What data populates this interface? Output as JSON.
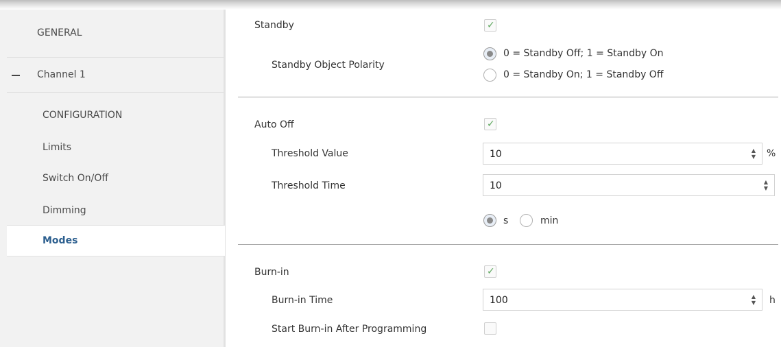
{
  "sidebar": {
    "general": "GENERAL",
    "channel": "Channel 1",
    "items": [
      "CONFIGURATION",
      "Limits",
      "Switch On/Off",
      "Dimming"
    ],
    "selected": "Modes"
  },
  "standby": {
    "label": "Standby",
    "checked": true,
    "polarity_label": "Standby Object Polarity",
    "options": [
      "0 = Standby Off; 1 = Standby On",
      "0 = Standby On; 1 = Standby Off"
    ],
    "selected_index": 0
  },
  "auto_off": {
    "label": "Auto Off",
    "checked": true,
    "threshold_value_label": "Threshold Value",
    "threshold_value": "10",
    "threshold_value_unit": "%",
    "threshold_time_label": "Threshold Time",
    "threshold_time": "10",
    "time_units": [
      "s",
      "min"
    ],
    "time_unit_selected_index": 0
  },
  "burn_in": {
    "label": "Burn-in",
    "checked": true,
    "time_label": "Burn-in Time",
    "time_value": "100",
    "time_unit": "h",
    "start_after_label": "Start Burn-in After Programming",
    "start_after_checked": false
  },
  "icons": {
    "check": "✓",
    "spin_up": "▲",
    "spin_down": "▼"
  },
  "colors": {
    "accent": "#2c5f8f",
    "check_green": "#5fa85f"
  }
}
